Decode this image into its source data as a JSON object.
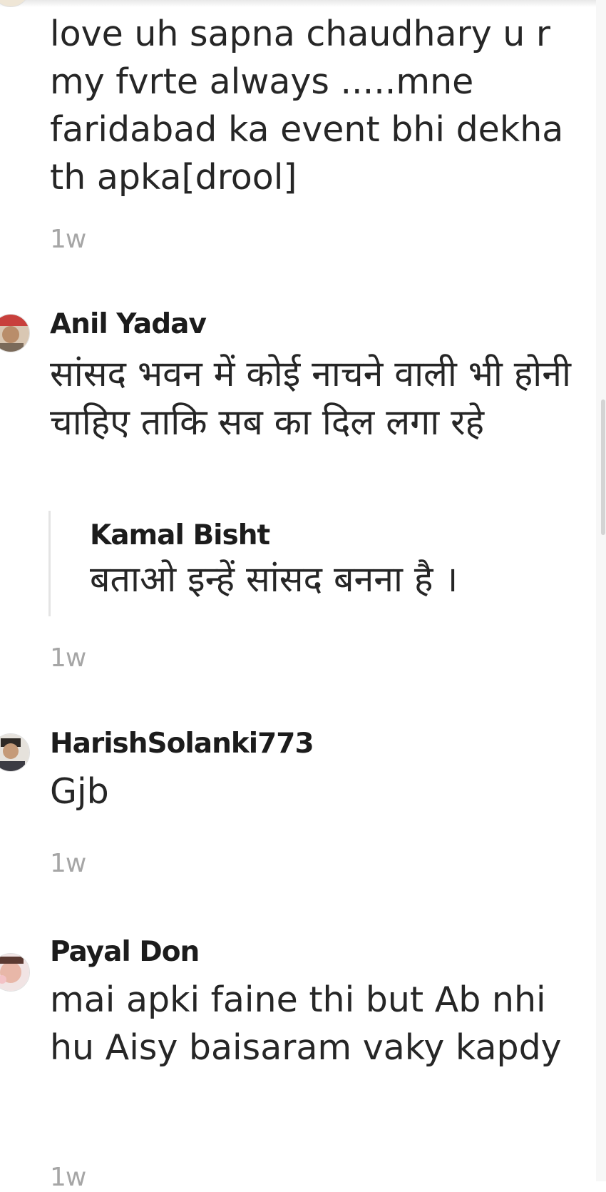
{
  "comments": [
    {
      "author": "",
      "text": "love uh sapna chaudhary u r my fvrte always .....mne faridabad ka event bhi dekha th apka[drool]",
      "time": "1w"
    },
    {
      "author": "Anil Yadav",
      "text": "सांसद भवन में कोई नाचने वाली भी होनी चाहिए ताकि सब का दिल लगा रहे",
      "reply": {
        "author": "Kamal Bisht",
        "text": "बताओ इन्हें सांसद बनना है ।"
      },
      "time": "1w"
    },
    {
      "author": "HarishSolanki773",
      "text": "Gjb",
      "time": "1w"
    },
    {
      "author": "Payal Don",
      "text": "mai apki faine thi but Ab nhi hu Aisy baisaram vaky kapdy",
      "time": "1w"
    }
  ]
}
